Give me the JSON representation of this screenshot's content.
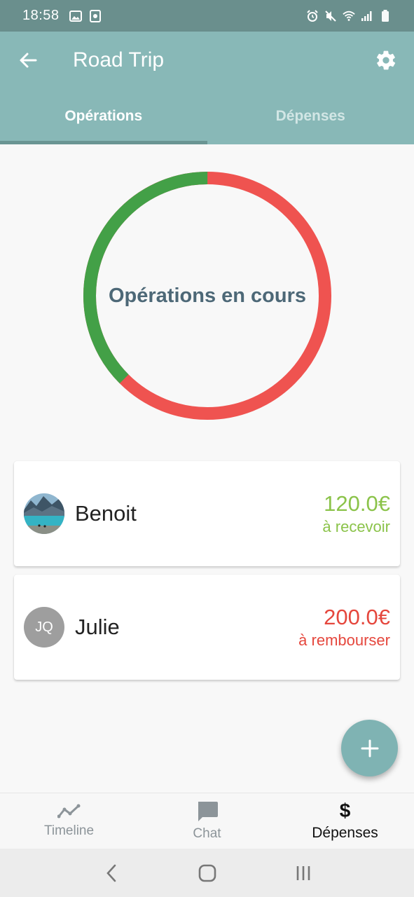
{
  "status_bar": {
    "time": "18:58",
    "left_icons": [
      "image-icon",
      "screenshot-icon"
    ],
    "right_icons": [
      "alarm-icon",
      "mute-icon",
      "wifi-icon",
      "signal-icon",
      "battery-icon"
    ]
  },
  "app_bar": {
    "title": "Road Trip",
    "back_icon": "arrow-back-icon",
    "settings_icon": "gear-icon"
  },
  "tabs": [
    {
      "label": "Opérations",
      "active": true
    },
    {
      "label": "Dépenses",
      "active": false
    }
  ],
  "summary": {
    "center_label": "Opérations en cours",
    "ring": {
      "receive_fraction": 0.375,
      "pay_fraction": 0.625,
      "receive_color": "#43a047",
      "pay_color": "#ef5350"
    }
  },
  "operations": [
    {
      "name": "Benoit",
      "avatar": "photo-lake",
      "amount": "120.0€",
      "status": "à recevoir",
      "color": "#8bc34a"
    },
    {
      "name": "Julie",
      "initials": "JQ",
      "amount": "200.0€",
      "status": "à rembourser",
      "color": "#e5473d"
    }
  ],
  "fab": {
    "icon": "plus-icon"
  },
  "bottom_nav": [
    {
      "label": "Timeline",
      "icon": "timeline-icon",
      "active": false
    },
    {
      "label": "Chat",
      "icon": "chat-icon",
      "active": false
    },
    {
      "label": "Dépenses",
      "icon": "dollar-icon",
      "active": true
    }
  ],
  "system_nav": [
    "back-chevron-icon",
    "home-icon",
    "recents-icon"
  ],
  "colors": {
    "primary": "#88b8b7",
    "status_bar": "#6a8f8d",
    "accent_fab": "#7fb3b3"
  }
}
